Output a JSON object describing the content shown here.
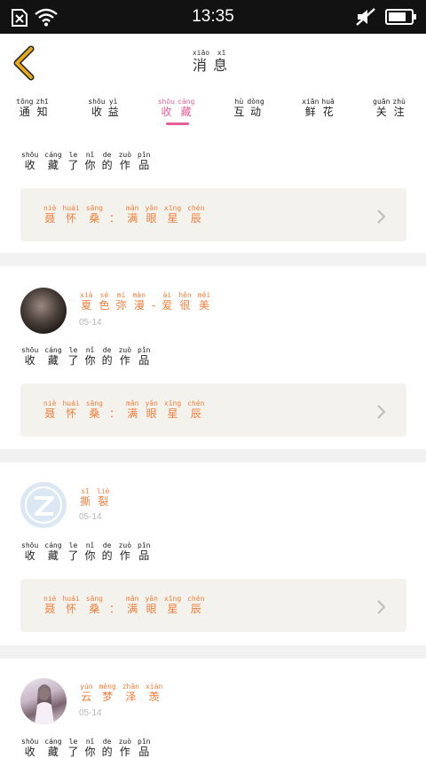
{
  "status_bar": {
    "time": "13:35"
  },
  "header": {
    "title": [
      {
        "char": "消",
        "py": "xiāo"
      },
      {
        "char": "息",
        "py": "xī"
      }
    ],
    "accent": "#e6a817"
  },
  "tabs": [
    {
      "chars": [
        {
          "char": "通",
          "py": "tōng"
        },
        {
          "char": "知",
          "py": "zhī"
        }
      ],
      "active": false
    },
    {
      "chars": [
        {
          "char": "收",
          "py": "shōu"
        },
        {
          "char": "益",
          "py": "yì"
        }
      ],
      "active": false
    },
    {
      "chars": [
        {
          "char": "收",
          "py": "shōu"
        },
        {
          "char": "藏",
          "py": "cáng"
        }
      ],
      "active": true
    },
    {
      "chars": [
        {
          "char": "互",
          "py": "hù"
        },
        {
          "char": "动",
          "py": "dòng"
        }
      ],
      "active": false
    },
    {
      "chars": [
        {
          "char": "鲜",
          "py": "xiān"
        },
        {
          "char": "花",
          "py": "huā"
        }
      ],
      "active": false
    },
    {
      "chars": [
        {
          "char": "关",
          "py": "guān"
        },
        {
          "char": "注",
          "py": "zhù"
        }
      ],
      "active": false
    }
  ],
  "action_text": [
    {
      "char": "收",
      "py": "shōu"
    },
    {
      "char": "藏",
      "py": "cáng"
    },
    {
      "char": "了",
      "py": "le"
    },
    {
      "char": "你",
      "py": "nǐ"
    },
    {
      "char": "的",
      "py": "de"
    },
    {
      "char": "作",
      "py": "zuò"
    },
    {
      "char": "品",
      "py": "pǐn"
    }
  ],
  "work_title": [
    {
      "char": "聂",
      "py": "niè"
    },
    {
      "char": "怀",
      "py": "huái"
    },
    {
      "char": "桑",
      "py": "sāng"
    },
    {
      "char": "：",
      "py": ""
    },
    {
      "char": "满",
      "py": "mǎn"
    },
    {
      "char": "眼",
      "py": "yǎn"
    },
    {
      "char": "星",
      "py": "xīng"
    },
    {
      "char": "辰",
      "py": "chén"
    }
  ],
  "items": [
    {
      "user": [
        {
          "char": "夏",
          "py": "xià"
        },
        {
          "char": "色",
          "py": "sè"
        },
        {
          "char": "弥",
          "py": "mí"
        },
        {
          "char": "漫",
          "py": "màn"
        },
        {
          "char": "-",
          "py": ""
        },
        {
          "char": "爱",
          "py": "ài"
        },
        {
          "char": "很",
          "py": "hěn"
        },
        {
          "char": "美",
          "py": "měi"
        }
      ],
      "date": "05-14",
      "avatar": "photo-dark"
    },
    {
      "user": [
        {
          "char": "撕",
          "py": "sī"
        },
        {
          "char": "裂",
          "py": "liè"
        }
      ],
      "date": "05-14",
      "avatar": "default-z"
    },
    {
      "user": [
        {
          "char": "云",
          "py": "yún"
        },
        {
          "char": "梦",
          "py": "mèng"
        },
        {
          "char": "泽",
          "py": "zhǎn"
        },
        {
          "char": "羡",
          "py": "xiàn"
        }
      ],
      "date": "05-14",
      "avatar": "photo-figure"
    }
  ],
  "colors": {
    "accent_pink": "#e8609a",
    "name_orange": "#f07f3c",
    "date_gray": "#b8b8b8"
  }
}
